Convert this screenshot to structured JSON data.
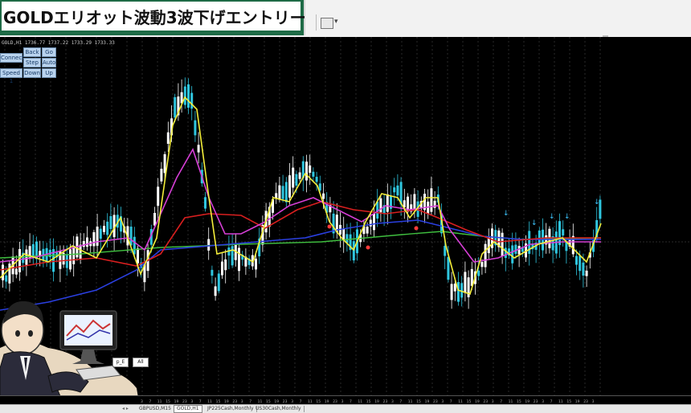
{
  "banner": {
    "title": "GOLDエリオット波動3波下げエントリー"
  },
  "ohlc": {
    "text": "GOLD,H1  1736.77 1737.22 1733.29 1733.33"
  },
  "controls": {
    "back": "Back",
    "go": "Go",
    "connect": "Connect",
    "step": "Step",
    "auto": "Auto",
    "speed": "Speed 1",
    "down": "Down",
    "up": "Up"
  },
  "mini_buttons": {
    "left": "p_E",
    "right": "All"
  },
  "hour_ticks": [
    "3",
    "7",
    "11",
    "15",
    "19",
    "23",
    "3",
    "7",
    "11",
    "15",
    "19",
    "23",
    "3",
    "7",
    "11",
    "15",
    "19",
    "23",
    "3",
    "7",
    "11",
    "15",
    "19",
    "23",
    "3",
    "7",
    "11",
    "15",
    "19",
    "23",
    "3",
    "7",
    "11",
    "15",
    "19",
    "23",
    "3",
    "7",
    "11",
    "15",
    "19",
    "23",
    "3",
    "7",
    "11",
    "15",
    "19",
    "23",
    "3",
    "7",
    "11",
    "15",
    "19",
    "23",
    "3"
  ],
  "date_ticks": [
    "16 Mar 10:00",
    "17 Mar 06:00",
    "18 Mar 03:00",
    "18 Mar 11:00",
    "18 Mar 20:00",
    "19 Mar 04:00",
    "19 Mar 13:00",
    "19 Mar 20:00",
    "20 Mar 05:00",
    "22 Mar 13:00",
    "22 Mar 21:00",
    "23 Mar 05:00",
    "23 Mar 14:00",
    "23 Mar 22:00",
    "24 Mar 07:00",
    "24 Mar 15:00",
    "25 Mar 00:00",
    "25 Mar 16:00"
  ],
  "tabs": [
    "GBPUSD,M15",
    "GOLD,H1",
    "JP225Cash,Monthly",
    "US30Cash,Monthly"
  ],
  "active_tab": "GOLD,H1",
  "colors": {
    "ma_yellow": "#f4ee3a",
    "ma_magenta": "#d63fd6",
    "ma_red": "#d81f1f",
    "ma_blue": "#2a3fe0",
    "ma_green": "#3fbf3f",
    "bull": "#2fc6df",
    "bear": "#ffffff",
    "grid": "#2a2a2a",
    "banner": "#1e6b46"
  }
}
